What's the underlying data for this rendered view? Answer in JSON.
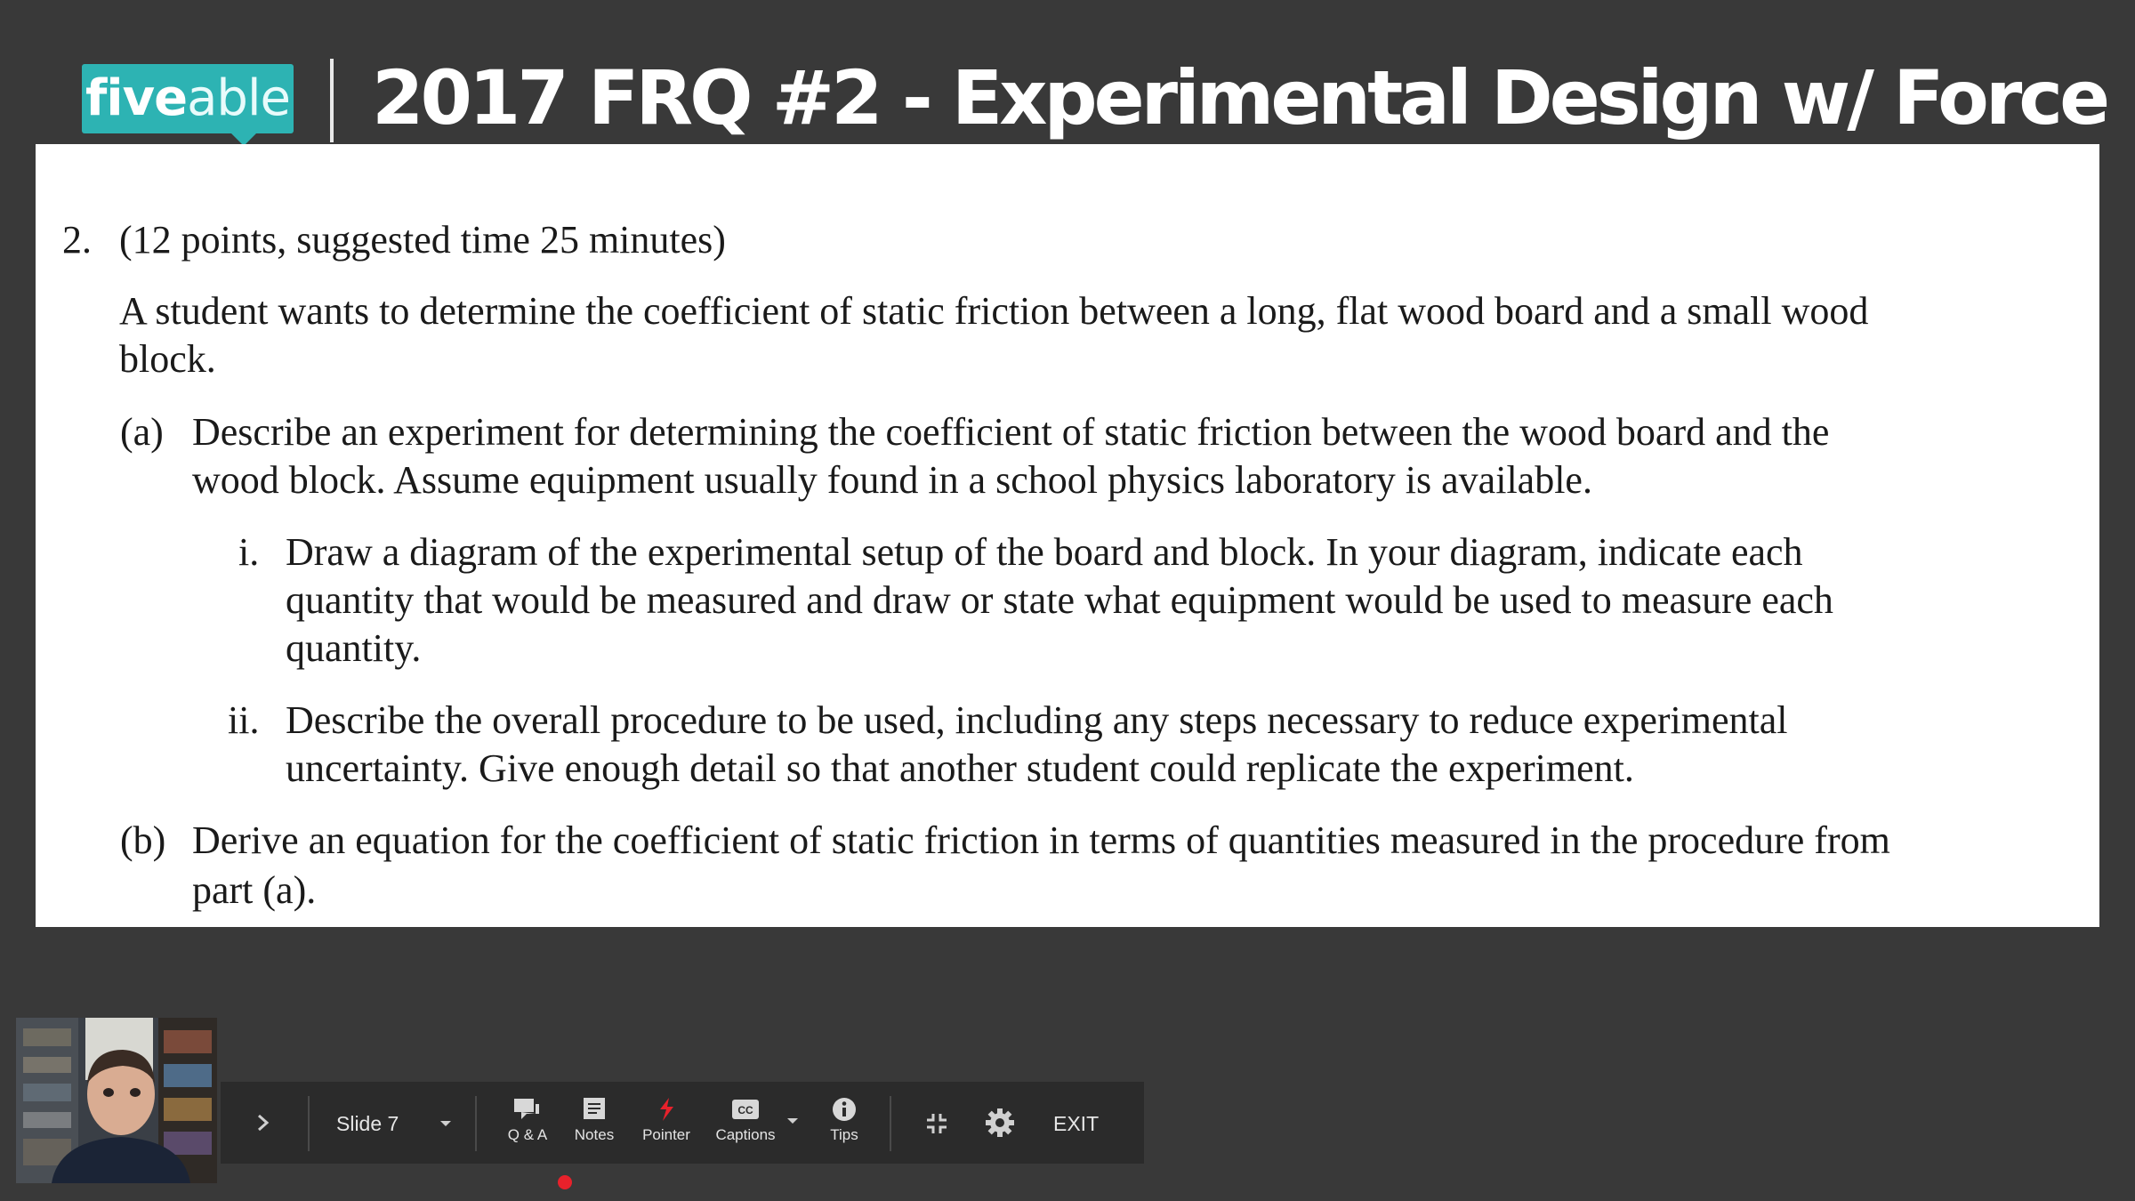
{
  "header": {
    "logo_part1": "five",
    "logo_part2": "able",
    "title": "2017 FRQ #2 - Experimental Design w/ Force"
  },
  "slide": {
    "q_number": "2.",
    "q_header": "(12 points, suggested time 25 minutes)",
    "intro_line1": "A student wants to determine the coefficient of static friction between a long, flat wood board and a small wood",
    "intro_line2": "block.",
    "a_label": "(a)",
    "a_line1": "Describe an experiment for determining the coefficient of static friction between the wood board and the",
    "a_line2": "wood block. Assume equipment usually found in a school physics laboratory is available.",
    "i_label": "i.",
    "i_line1": "Draw a diagram of the experimental setup of the board and block. In your diagram, indicate each",
    "i_line2": "quantity that would be measured and draw or state what equipment would be used to measure each",
    "i_line3": "quantity.",
    "ii_label": "ii.",
    "ii_line1": "Describe the overall procedure to be used, including any steps necessary to reduce experimental",
    "ii_line2": "uncertainty. Give enough detail so that another student could replicate the experiment.",
    "b_label": "(b)",
    "b_line1": "Derive an equation for the coefficient of static friction in terms of quantities measured in the procedure from",
    "b_line2": "part (a)."
  },
  "toolbar": {
    "slide_label": "Slide 7",
    "qa_label": "Q & A",
    "notes_label": "Notes",
    "pointer_label": "Pointer",
    "captions_label": "Captions",
    "tips_label": "Tips",
    "exit_label": "EXIT"
  },
  "colors": {
    "background": "#393939",
    "brand_teal": "#2db3b3",
    "toolbar_bg": "#2b2b2b",
    "pointer_red": "#e8212b",
    "recording_dot": "#e8212b"
  },
  "icons": [
    "chevron-right-icon",
    "dropdown-arrow-icon",
    "chat-icon",
    "notes-icon",
    "pointer-icon",
    "captions-icon",
    "info-icon",
    "exit-fullscreen-icon",
    "gear-icon"
  ]
}
